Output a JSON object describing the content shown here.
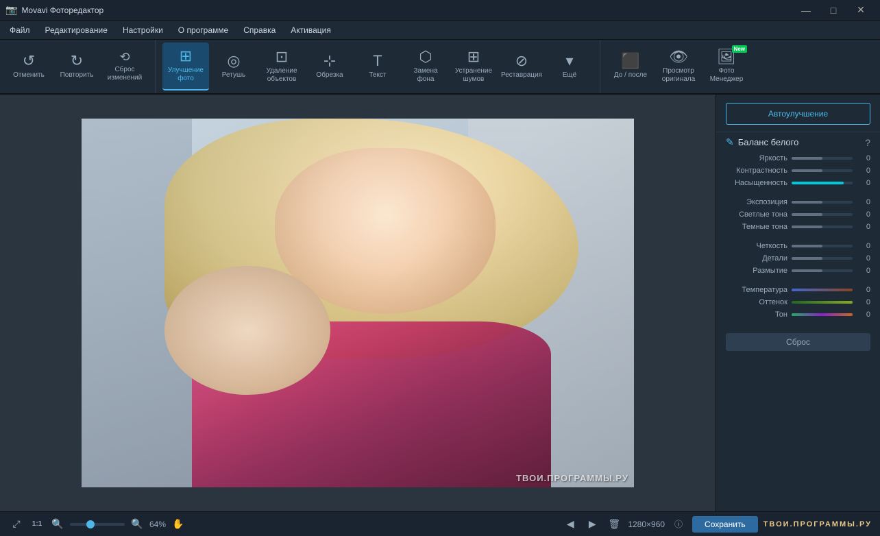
{
  "app": {
    "title": "Movavi Фоторедактор",
    "icon": "📷"
  },
  "window_controls": {
    "minimize": "—",
    "maximize": "□",
    "close": "✕"
  },
  "menubar": {
    "items": [
      "Файл",
      "Редактирование",
      "Настройки",
      "О программе",
      "Справка",
      "Активация"
    ]
  },
  "toolbar": {
    "undo_label": "Отменить",
    "redo_label": "Повторить",
    "reset_label": "Сброс\nизменений",
    "enhance_label": "Улучшение\nфото",
    "retouch_label": "Ретушь",
    "remove_obj_label": "Удаление\nобъектов",
    "crop_label": "Обрезка",
    "text_label": "Текст",
    "bg_replace_label": "Замена\nфона",
    "denoise_label": "Устранение\nшумов",
    "restore_label": "Реставрация",
    "more_label": "Ещё",
    "before_after_label": "До / после",
    "view_original_label": "Просмотр\nоригинала",
    "photo_manager_label": "Фото\nМенеджер",
    "new_badge": "New"
  },
  "right_panel": {
    "auto_enhance_label": "Автоулучшение",
    "white_balance_label": "Баланс белого",
    "help_symbol": "?",
    "sliders": [
      {
        "label": "Яркость",
        "value": "0",
        "fill_type": "gray",
        "fill_pct": 50
      },
      {
        "label": "Контрастность",
        "value": "0",
        "fill_type": "gray",
        "fill_pct": 50
      },
      {
        "label": "Насыщенность",
        "value": "0",
        "fill_type": "cyan",
        "fill_pct": 85
      },
      {
        "label": "Экспозиция",
        "value": "0",
        "fill_type": "gray",
        "fill_pct": 50
      },
      {
        "label": "Светлые тона",
        "value": "0",
        "fill_type": "gray",
        "fill_pct": 50
      },
      {
        "label": "Темные тона",
        "value": "0",
        "fill_type": "gray",
        "fill_pct": 50
      },
      {
        "label": "Четкость",
        "value": "0",
        "fill_type": "gray",
        "fill_pct": 50
      },
      {
        "label": "Детали",
        "value": "0",
        "fill_type": "gray",
        "fill_pct": 50
      },
      {
        "label": "Размытие",
        "value": "0",
        "fill_type": "gray",
        "fill_pct": 50
      },
      {
        "label": "Температура",
        "value": "0",
        "fill_type": "temperature",
        "fill_pct": 100
      },
      {
        "label": "Оттенок",
        "value": "0",
        "fill_type": "hue",
        "fill_pct": 100
      },
      {
        "label": "Тон",
        "value": "0",
        "fill_type": "tone",
        "fill_pct": 100
      }
    ],
    "reset_label": "Сброс"
  },
  "statusbar": {
    "zoom_percent": "64%",
    "image_size": "1280×960",
    "info_symbol": "ⓘ",
    "save_label": "Сохранить",
    "watermark": "ТВОИ.ПРОГРАММЫ.РУ"
  }
}
